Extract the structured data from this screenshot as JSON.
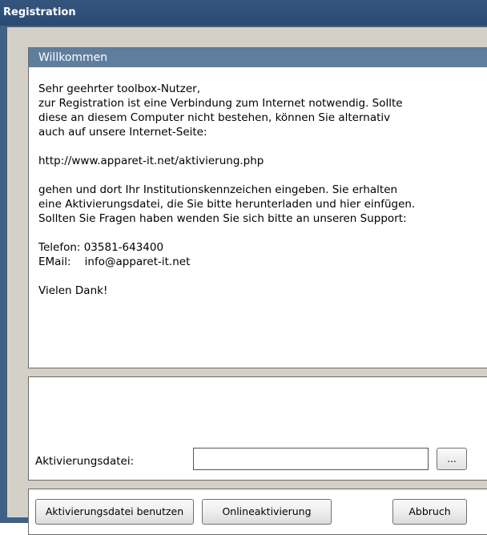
{
  "window": {
    "title": "Registration"
  },
  "welcome": {
    "header": "Willkommen",
    "lines": {
      "l1": "Sehr geehrter toolbox-Nutzer,",
      "l2": "zur Registration ist eine Verbindung zum Internet notwendig. Sollte",
      "l3": "diese an diesem Computer nicht bestehen, können Sie alternativ",
      "l4": "auch auf unsere Internet-Seite:",
      "l5": "http://www.apparet-it.net/aktivierung.php",
      "l6": "gehen und dort Ihr Institutionskennzeichen eingeben. Sie erhalten",
      "l7": "eine Aktivierungsdatei, die Sie bitte herunterladen und hier einfügen.",
      "l8": "Sollten Sie Fragen haben wenden Sie sich bitte an unseren Support:",
      "l9": "Telefon: 03581-643400",
      "l10": "EMail:    info@apparet-it.net",
      "l11": "Vielen Dank!"
    }
  },
  "activation": {
    "label": "Aktivierungsdatei:",
    "value": "",
    "placeholder": "",
    "browse_label": "..."
  },
  "buttons": {
    "use_file": "Aktivierungsdatei benutzen",
    "online": "Onlineaktivierung",
    "cancel": "Abbruch"
  }
}
